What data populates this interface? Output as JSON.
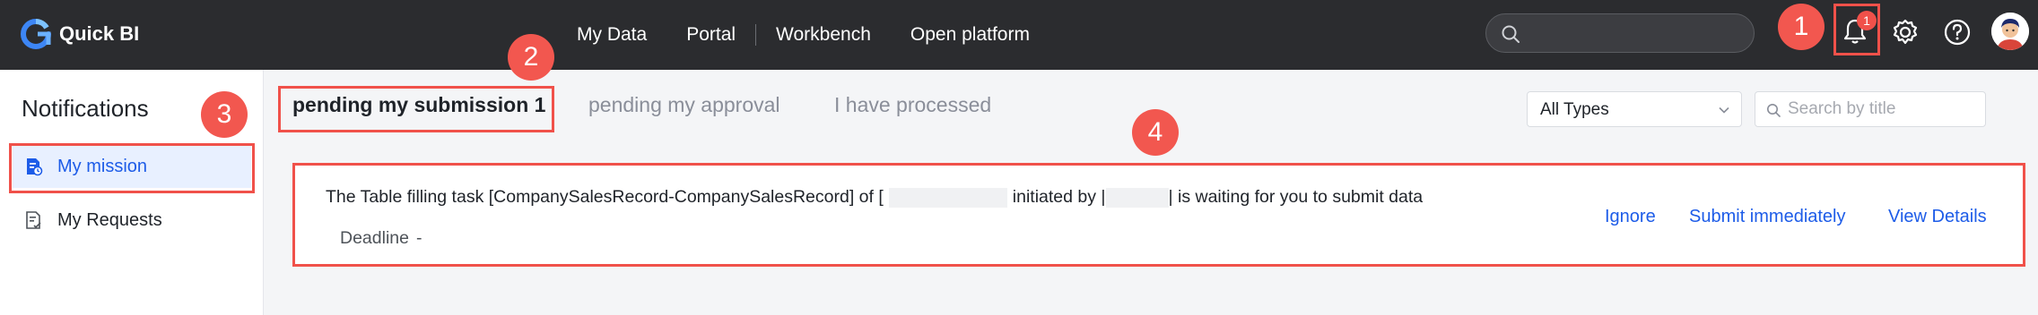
{
  "app": {
    "name": "Quick BI"
  },
  "nav": {
    "items": [
      "My Data",
      "Portal",
      "Workbench",
      "Open platform"
    ]
  },
  "header": {
    "search_placeholder": "",
    "notification_count": "1"
  },
  "sidebar": {
    "title": "Notifications",
    "items": [
      {
        "label": "My mission",
        "icon": "task-document-icon"
      },
      {
        "label": "My Requests",
        "icon": "request-document-icon"
      }
    ]
  },
  "tabs": [
    {
      "label": "pending my submission 1"
    },
    {
      "label": "pending my approval"
    },
    {
      "label": "I have processed"
    }
  ],
  "filters": {
    "type_value": "All Types",
    "search_placeholder": "Search by title"
  },
  "task": {
    "message_part1": "The Table filling task [CompanySalesRecord-CompanySalesRecord] of [",
    "message_part2": "initiated by |",
    "message_part3": "| is waiting for you to submit data",
    "deadline_label": "Deadline",
    "deadline_value": "-",
    "actions": [
      "Ignore",
      "Submit immediately",
      "View Details"
    ]
  },
  "annotations": [
    "1",
    "2",
    "3",
    "4"
  ],
  "colors": {
    "topbar": "#2b2c2f",
    "accent_blue": "#1d5ce8",
    "annotation_red": "#f0514a"
  }
}
